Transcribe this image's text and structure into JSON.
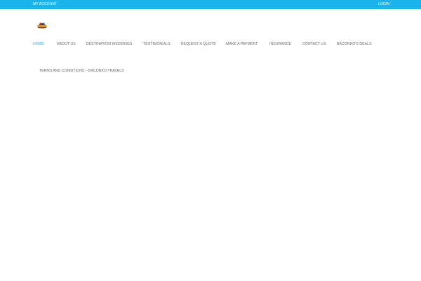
{
  "topbar": {
    "my_account": "MY ACCOUNT",
    "login": "LOGIN"
  },
  "logo": {
    "icon": "baconko-travels-logo"
  },
  "nav": {
    "items": [
      {
        "label": "HOME",
        "active": true
      },
      {
        "label": "ABOUT US"
      },
      {
        "label": "DESTINATION WEDDINGS"
      },
      {
        "label": "TESTIMONIALS"
      },
      {
        "label": "REQUEST A QUOTE"
      },
      {
        "label": "MAKE A PAYMENT"
      },
      {
        "label": "INSURANCE"
      },
      {
        "label": "CONTACT US"
      },
      {
        "label": "BACONKO'S DEALS"
      }
    ],
    "secondary": "TERMS AND CONDITIONS – BACONKO TRAVELS"
  },
  "colors": {
    "accent": "#1ab4ea",
    "nav_text": "#6e6e6e"
  }
}
